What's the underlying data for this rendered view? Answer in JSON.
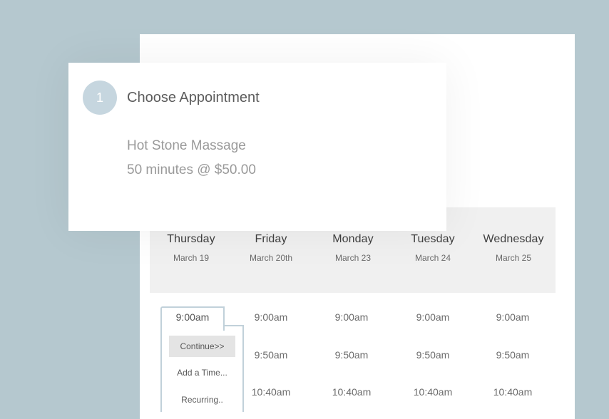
{
  "step": {
    "number": "1",
    "title": "Choose Appointment"
  },
  "service": {
    "name": "Hot Stone Massage",
    "details": "50 minutes @ $50.00"
  },
  "days": [
    {
      "name": "Thursday",
      "date": "March 19",
      "slots": [
        "9:00am"
      ]
    },
    {
      "name": "Friday",
      "date": "March 20th",
      "slots": [
        "9:00am",
        "9:50am",
        "10:40am"
      ]
    },
    {
      "name": "Monday",
      "date": "March 23",
      "slots": [
        "9:00am",
        "9:50am",
        "10:40am"
      ]
    },
    {
      "name": "Tuesday",
      "date": "March 24",
      "slots": [
        "9:00am",
        "9:50am",
        "10:40am"
      ]
    },
    {
      "name": "Wednesday",
      "date": "March 25",
      "slots": [
        "9:00am",
        "9:50am",
        "10:40am"
      ]
    }
  ],
  "selected_slot": {
    "time": "9:00am",
    "actions": {
      "continue": "Continue>>",
      "add_time": "Add a Time...",
      "recurring": "Recurring.."
    }
  },
  "colors": {
    "background": "#b5c8cf",
    "accent": "#c6d6df",
    "header_bg": "#f0f0f0"
  }
}
